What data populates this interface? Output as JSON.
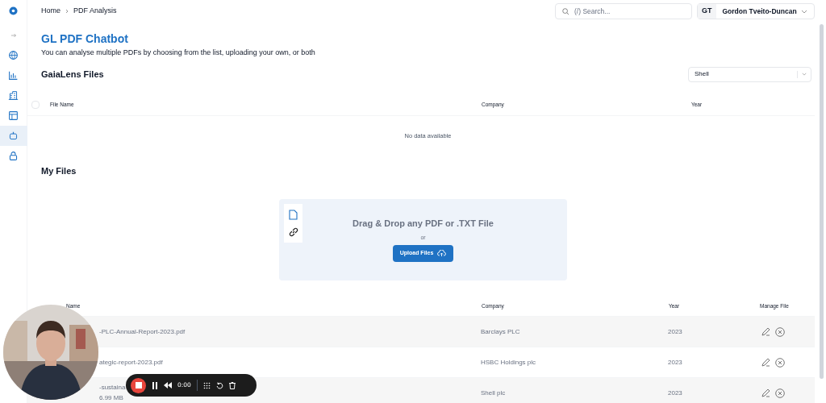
{
  "sidebar": {
    "items": [
      {
        "selected": false
      },
      {
        "selected": false
      },
      {
        "selected": false
      },
      {
        "selected": false
      },
      {
        "selected": false
      },
      {
        "selected": true
      },
      {
        "selected": false
      }
    ]
  },
  "breadcrumb": [
    "Home",
    "PDF Analysis"
  ],
  "search": {
    "placeholder": "(/) Search..."
  },
  "user": {
    "initials": "GT",
    "name": "Gordon Tveito-Duncan"
  },
  "title": "GL PDF Chatbot",
  "subtitle": "You can analyse multiple PDFs by choosing from the list, uploading your own, or both",
  "gaialens": {
    "heading": "GaiaLens Files",
    "filter": "Shell",
    "select_all_checked": false,
    "columns": [
      "File Name",
      "Company",
      "Year"
    ],
    "empty": "No data available"
  },
  "my_files": {
    "heading": "My Files",
    "dropzone": {
      "title": "Drag & Drop any PDF or .TXT File",
      "or": "or",
      "button": "Upload Files"
    },
    "columns": [
      "Name",
      "Company",
      "Year",
      "Manage File"
    ],
    "rows": [
      {
        "file_name": "-PLC-Annual-Report-2023.pdf",
        "company": "Barclays PLC",
        "year": "2023"
      },
      {
        "file_name": "ategic-report-2023.pdf",
        "company": "HSBC Holdings plc",
        "year": "2023"
      },
      {
        "file_name": "-sustaina",
        "size": "6.99 MB",
        "company": "Shell plc",
        "year": "2023"
      }
    ]
  },
  "recorder": {
    "time": "0:00"
  },
  "webcam": {
    "kind": "picture"
  }
}
